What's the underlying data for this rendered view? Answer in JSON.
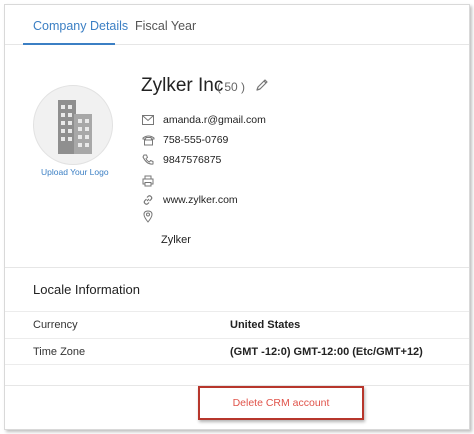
{
  "tabs": [
    {
      "label": "Company Details"
    },
    {
      "label": "Fiscal Year"
    }
  ],
  "logo": {
    "upload_label": "Upload Your Logo"
  },
  "company": {
    "name": "Zylker Inc",
    "employee_count": "( 50 )",
    "email": "amanda.r@gmail.com",
    "phone": "758-555-0769",
    "mobile": "9847576875",
    "fax": "",
    "website": "www.zylker.com",
    "address": "Zylker"
  },
  "locale": {
    "title": "Locale Information",
    "rows": [
      {
        "label": "Currency",
        "value": "United States"
      },
      {
        "label": "Time Zone",
        "value": "(GMT -12:0) GMT-12:00 (Etc/GMT+12)"
      }
    ]
  },
  "actions": {
    "delete_label": "Delete CRM account"
  },
  "colors": {
    "accent": "#3b7fc4",
    "danger": "#e0534a",
    "highlight": "#b7362c"
  },
  "icons": [
    "building-icon",
    "edit-icon",
    "mail-icon",
    "phone-icon",
    "mobile-icon",
    "fax-icon",
    "link-icon",
    "location-icon"
  ]
}
